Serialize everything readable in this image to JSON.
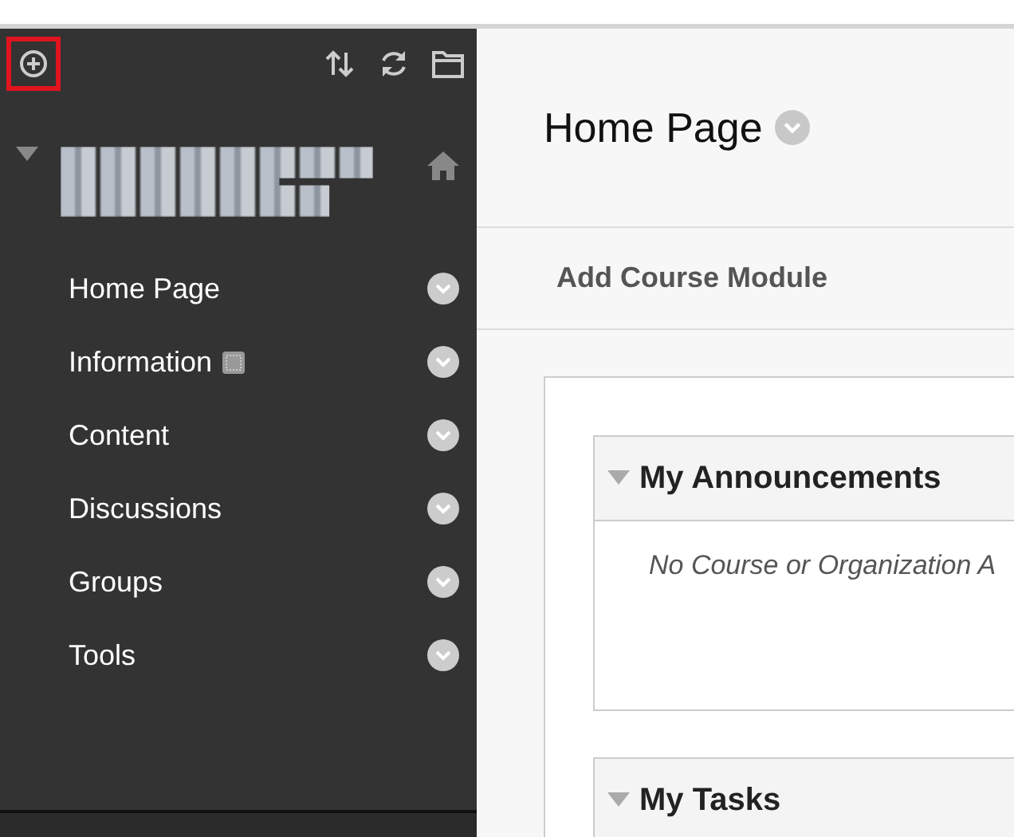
{
  "sidebar": {
    "toolbar": {
      "add_button": {
        "highlighted": true
      }
    },
    "course": {
      "expanded": true
    },
    "items": [
      {
        "label": "Home Page",
        "has_badge": false
      },
      {
        "label": "Information",
        "has_badge": true
      },
      {
        "label": "Content",
        "has_badge": false
      },
      {
        "label": "Discussions",
        "has_badge": false
      },
      {
        "label": "Groups",
        "has_badge": false
      },
      {
        "label": "Tools",
        "has_badge": false
      }
    ]
  },
  "page": {
    "title": "Home Page",
    "action": "Add Course Module",
    "modules": [
      {
        "title": "My Announcements",
        "expanded": true,
        "message": "No Course or Organization A"
      },
      {
        "title": "My Tasks",
        "expanded": true
      }
    ]
  }
}
